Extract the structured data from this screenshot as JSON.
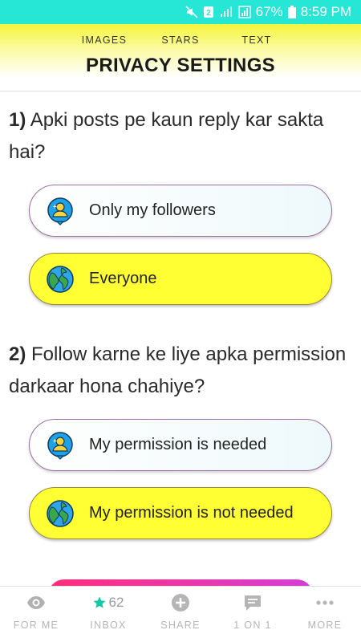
{
  "status_bar": {
    "battery": "67%",
    "time": "8:59 PM"
  },
  "header": {
    "tabs": [
      "IMAGES",
      "STARS",
      "TEXT"
    ],
    "title": "PRIVACY SETTINGS"
  },
  "questions": [
    {
      "number": "1)",
      "text": " Apki posts pe kaun reply kar sakta hai?",
      "options": [
        {
          "label": "Only my followers",
          "icon": "followers-icon",
          "selected": false
        },
        {
          "label": "Everyone",
          "icon": "globe-icon",
          "selected": true
        }
      ]
    },
    {
      "number": "2)",
      "text": " Follow karne ke liye apka permission darkaar hona chahiye?",
      "options": [
        {
          "label": "My permission is needed",
          "icon": "followers-icon",
          "selected": false
        },
        {
          "label": "My permission is not needed",
          "icon": "globe-icon",
          "selected": true
        }
      ]
    }
  ],
  "bottom_nav": {
    "items": [
      {
        "label": "FOR ME",
        "icon": "eye-icon"
      },
      {
        "label": "INBOX",
        "icon": "star-icon",
        "count": "62"
      },
      {
        "label": "SHARE",
        "icon": "plus-icon"
      },
      {
        "label": "1 ON 1",
        "icon": "chat-icon"
      },
      {
        "label": "MORE",
        "icon": "more-dots-icon"
      }
    ]
  },
  "colors": {
    "status_bar": "#26e6d6",
    "selected_option": "#ffff33",
    "accent_teal": "#13c9a5"
  }
}
